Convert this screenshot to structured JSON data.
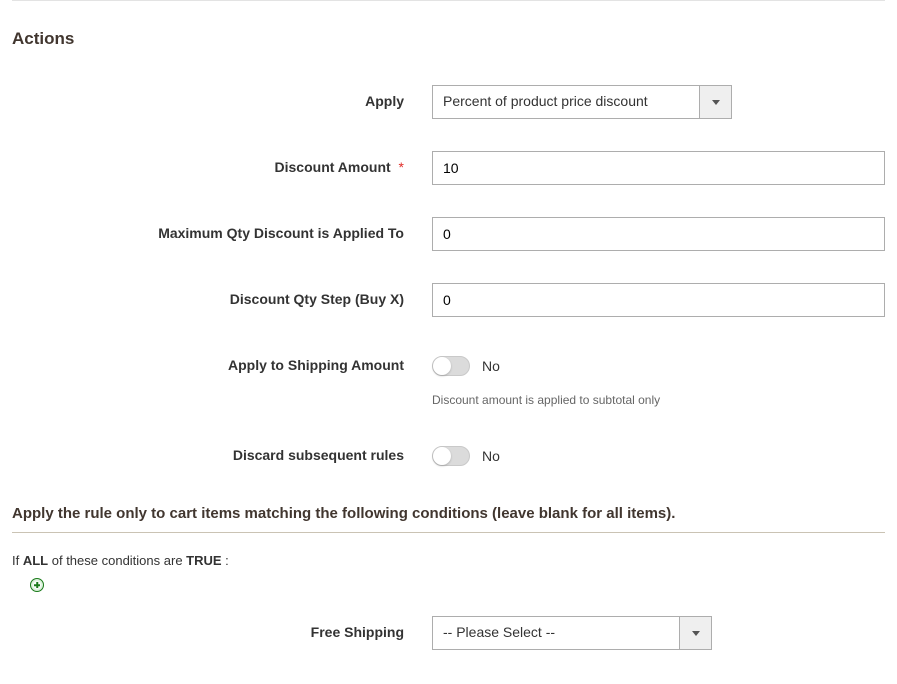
{
  "section_title": "Actions",
  "fields": {
    "apply": {
      "label": "Apply",
      "value": "Percent of product price discount"
    },
    "discount_amount": {
      "label": "Discount Amount",
      "value": "10",
      "required_mark": "*"
    },
    "max_qty": {
      "label": "Maximum Qty Discount is Applied To",
      "value": "0"
    },
    "qty_step": {
      "label": "Discount Qty Step (Buy X)",
      "value": "0"
    },
    "apply_shipping": {
      "label": "Apply to Shipping Amount",
      "state_label": "No",
      "note": "Discount amount is applied to subtotal only"
    },
    "discard_rules": {
      "label": "Discard subsequent rules",
      "state_label": "No"
    },
    "free_shipping": {
      "label": "Free Shipping",
      "value": "-- Please Select --"
    }
  },
  "conditions": {
    "heading": "Apply the rule only to cart items matching the following conditions (leave blank for all items).",
    "prefix_if": "If ",
    "aggregator": "ALL",
    "middle": "  of these conditions are ",
    "value": "TRUE",
    "suffix": " :"
  }
}
